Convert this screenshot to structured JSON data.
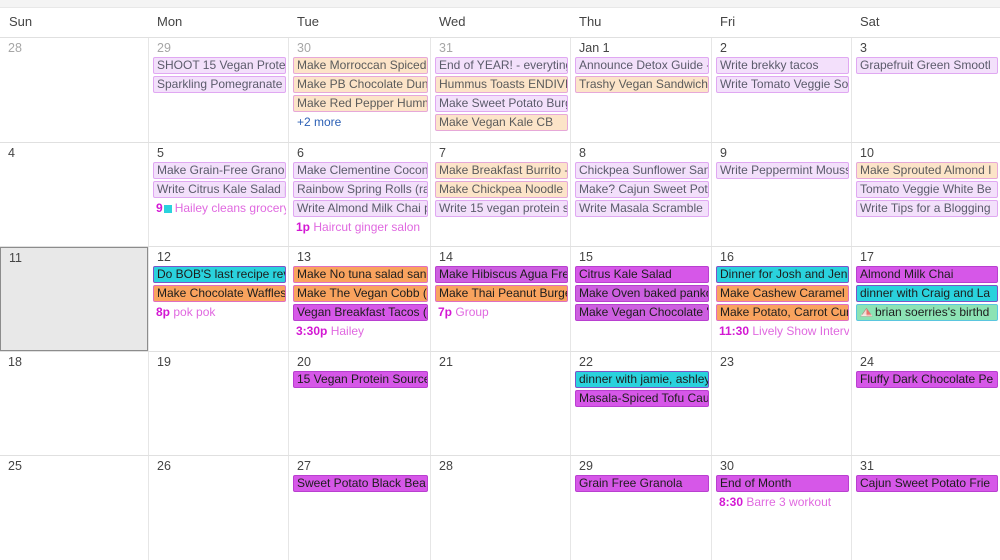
{
  "header": {
    "weekdays": [
      "Sun",
      "Mon",
      "Tue",
      "Wed",
      "Thu",
      "Fri",
      "Sat"
    ]
  },
  "colors": {
    "lavender": "#f3e0fb",
    "peach": "#fce4c8",
    "magenta": "#d657e8",
    "orange": "#f9a35e",
    "cyan": "#2ad2dd",
    "green": "#8ce3b4",
    "link": "#2b5fb5",
    "timed_text": "#e069e0",
    "selected_cell": "#e8e8e8"
  },
  "weeks": [
    {
      "days": [
        {
          "num": "28",
          "muted": true,
          "selected": false,
          "events": []
        },
        {
          "num": "29",
          "muted": true,
          "selected": false,
          "events": [
            {
              "title": "SHOOT 15 Vegan Prote",
              "style": "lav",
              "type": "allday"
            },
            {
              "title": "Sparkling Pomegranate I",
              "style": "lav",
              "type": "allday"
            }
          ]
        },
        {
          "num": "30",
          "muted": true,
          "selected": false,
          "events": [
            {
              "title": "Make Morroccan Spiced",
              "style": "peach",
              "type": "allday"
            },
            {
              "title": "Make PB Chocolate Dun",
              "style": "peach",
              "type": "allday"
            },
            {
              "title": "Make Red Pepper Humm",
              "style": "peach",
              "type": "allday"
            }
          ],
          "more": "+2 more"
        },
        {
          "num": "31",
          "muted": true,
          "selected": false,
          "events": [
            {
              "title": "End of YEAR! - everyting",
              "style": "lav",
              "type": "allday"
            },
            {
              "title": "Hummus Toasts ENDIVI",
              "style": "peach",
              "type": "allday"
            },
            {
              "title": "Make Sweet Potato Burg",
              "style": "lav",
              "type": "allday"
            },
            {
              "title": "Make Vegan Kale CB",
              "style": "peach",
              "type": "allday"
            }
          ]
        },
        {
          "num": "Jan 1",
          "muted": false,
          "selected": false,
          "events": [
            {
              "title": "Announce Detox Guide -",
              "style": "lav",
              "type": "allday"
            },
            {
              "title": "Trashy Vegan Sandwich",
              "style": "peach",
              "type": "allday"
            }
          ]
        },
        {
          "num": "2",
          "muted": false,
          "selected": false,
          "events": [
            {
              "title": "Write brekky tacos",
              "style": "lav",
              "type": "allday"
            },
            {
              "title": "Write Tomato Veggie So",
              "style": "lav",
              "type": "allday"
            }
          ]
        },
        {
          "num": "3",
          "muted": false,
          "selected": false,
          "events": [
            {
              "title": "Grapefruit Green Smootl",
              "style": "lav",
              "type": "allday"
            }
          ]
        }
      ]
    },
    {
      "days": [
        {
          "num": "4",
          "muted": false,
          "selected": false,
          "events": []
        },
        {
          "num": "5",
          "muted": false,
          "selected": false,
          "events": [
            {
              "title": "Make Grain-Free Granol",
              "style": "lav",
              "type": "allday"
            },
            {
              "title": "Write Citrus Kale Salad p",
              "style": "lav",
              "type": "allday"
            },
            {
              "time": "9",
              "title": "Hailey cleans grocery",
              "type": "timed",
              "bullet": true
            }
          ]
        },
        {
          "num": "6",
          "muted": false,
          "selected": false,
          "events": [
            {
              "title": "Make Clementine Cocon",
              "style": "lav",
              "type": "allday"
            },
            {
              "title": "Rainbow Spring Rolls (ra",
              "style": "lav",
              "type": "allday"
            },
            {
              "title": "Write Almond Milk Chai p",
              "style": "lav",
              "type": "allday"
            },
            {
              "time": "1p",
              "title": "Haircut ginger salon",
              "type": "timed"
            }
          ]
        },
        {
          "num": "7",
          "muted": false,
          "selected": false,
          "events": [
            {
              "title": "Make Breakfast Burrito -",
              "style": "peach",
              "type": "allday"
            },
            {
              "title": "Make Chickpea Noodle S",
              "style": "peach",
              "type": "allday"
            },
            {
              "title": "Write 15 vegan protein s",
              "style": "lav",
              "type": "allday"
            }
          ]
        },
        {
          "num": "8",
          "muted": false,
          "selected": false,
          "events": [
            {
              "title": "Chickpea Sunflower San",
              "style": "lav",
              "type": "allday"
            },
            {
              "title": "Make? Cajun Sweet Pot",
              "style": "lav",
              "type": "allday"
            },
            {
              "title": "Write Masala Scramble",
              "style": "lav",
              "type": "allday"
            }
          ]
        },
        {
          "num": "9",
          "muted": false,
          "selected": false,
          "events": [
            {
              "title": "Write Peppermint Mouss",
              "style": "lav",
              "type": "allday"
            }
          ]
        },
        {
          "num": "10",
          "muted": false,
          "selected": false,
          "events": [
            {
              "title": "Make Sprouted Almond I",
              "style": "peach",
              "type": "allday"
            },
            {
              "title": "Tomato Veggie White Be",
              "style": "lav",
              "type": "allday"
            },
            {
              "title": "Write Tips for a Blogging",
              "style": "lav",
              "type": "allday"
            }
          ]
        }
      ]
    },
    {
      "days": [
        {
          "num": "11",
          "muted": false,
          "selected": true,
          "events": []
        },
        {
          "num": "12",
          "muted": false,
          "selected": false,
          "events": [
            {
              "title": "Do BOB'S last recipe rev",
              "style": "cyan",
              "type": "allday"
            },
            {
              "title": "Make Chocolate Waffles",
              "style": "orange",
              "type": "allday"
            },
            {
              "time": "8p",
              "title": "pok pok",
              "type": "timed"
            }
          ]
        },
        {
          "num": "13",
          "muted": false,
          "selected": false,
          "events": [
            {
              "title": "Make No tuna salad san",
              "style": "orange",
              "type": "allday"
            },
            {
              "title": "Make The Vegan Cobb (",
              "style": "orange",
              "type": "allday"
            },
            {
              "title": "Vegan Breakfast Tacos (",
              "style": "magenta",
              "type": "allday"
            },
            {
              "time": "3:30p",
              "title": "Hailey",
              "type": "timed"
            }
          ]
        },
        {
          "num": "14",
          "muted": false,
          "selected": false,
          "events": [
            {
              "title": "Make Hibiscus Agua Fre",
              "style": "magenta-light",
              "type": "allday"
            },
            {
              "title": "Make Thai Peanut Burge",
              "style": "orange",
              "type": "allday"
            },
            {
              "time": "7p",
              "title": "Group",
              "type": "timed"
            }
          ]
        },
        {
          "num": "15",
          "muted": false,
          "selected": false,
          "events": [
            {
              "title": "Citrus Kale Salad",
              "style": "magenta",
              "type": "allday"
            },
            {
              "title": "Make Oven baked panko",
              "style": "magenta-light",
              "type": "allday"
            },
            {
              "title": "Make Vegan Chocolate '",
              "style": "magenta-light",
              "type": "allday"
            }
          ]
        },
        {
          "num": "16",
          "muted": false,
          "selected": false,
          "events": [
            {
              "title": "Dinner for Josh and Jen!",
              "style": "cyan",
              "type": "allday"
            },
            {
              "title": "Make Cashew Caramel S",
              "style": "orange",
              "type": "allday"
            },
            {
              "title": "Make Potato, Carrot Cur",
              "style": "orange",
              "type": "allday"
            },
            {
              "time": "11:30",
              "title": "Lively Show Intervie",
              "type": "timed"
            }
          ]
        },
        {
          "num": "17",
          "muted": false,
          "selected": false,
          "events": [
            {
              "title": "Almond Milk Chai",
              "style": "magenta",
              "type": "allday"
            },
            {
              "title": "dinner with Craig and La",
              "style": "cyan",
              "type": "allday"
            },
            {
              "title": "brian soerries's birthd",
              "style": "green",
              "type": "allday",
              "icon": "cake-icon"
            }
          ]
        }
      ]
    },
    {
      "days": [
        {
          "num": "18",
          "muted": false,
          "selected": false,
          "events": []
        },
        {
          "num": "19",
          "muted": false,
          "selected": false,
          "events": []
        },
        {
          "num": "20",
          "muted": false,
          "selected": false,
          "events": [
            {
              "title": "15 Vegan Protein Source",
              "style": "magenta",
              "type": "allday"
            }
          ]
        },
        {
          "num": "21",
          "muted": false,
          "selected": false,
          "events": []
        },
        {
          "num": "22",
          "muted": false,
          "selected": false,
          "events": [
            {
              "title": "dinner with jamie, ashley",
              "style": "cyan",
              "type": "allday"
            },
            {
              "title": "Masala-Spiced Tofu Cau",
              "style": "magenta",
              "type": "allday"
            }
          ]
        },
        {
          "num": "23",
          "muted": false,
          "selected": false,
          "events": []
        },
        {
          "num": "24",
          "muted": false,
          "selected": false,
          "events": [
            {
              "title": "Fluffy Dark Chocolate Pe",
              "style": "magenta",
              "type": "allday"
            }
          ]
        }
      ]
    },
    {
      "days": [
        {
          "num": "25",
          "muted": false,
          "selected": false,
          "events": []
        },
        {
          "num": "26",
          "muted": false,
          "selected": false,
          "events": []
        },
        {
          "num": "27",
          "muted": false,
          "selected": false,
          "events": [
            {
              "title": "Sweet Potato Black Bea",
              "style": "magenta",
              "type": "allday"
            }
          ]
        },
        {
          "num": "28",
          "muted": false,
          "selected": false,
          "events": []
        },
        {
          "num": "29",
          "muted": false,
          "selected": false,
          "events": [
            {
              "title": "Grain Free Granola",
              "style": "magenta",
              "type": "allday"
            }
          ]
        },
        {
          "num": "30",
          "muted": false,
          "selected": false,
          "events": [
            {
              "title": "End of Month",
              "style": "magenta",
              "type": "allday"
            },
            {
              "time": "8:30",
              "title": "Barre 3 workout",
              "type": "timed"
            }
          ]
        },
        {
          "num": "31",
          "muted": false,
          "selected": false,
          "events": [
            {
              "title": "Cajun Sweet Potato Frie",
              "style": "magenta",
              "type": "allday"
            }
          ]
        }
      ]
    }
  ]
}
